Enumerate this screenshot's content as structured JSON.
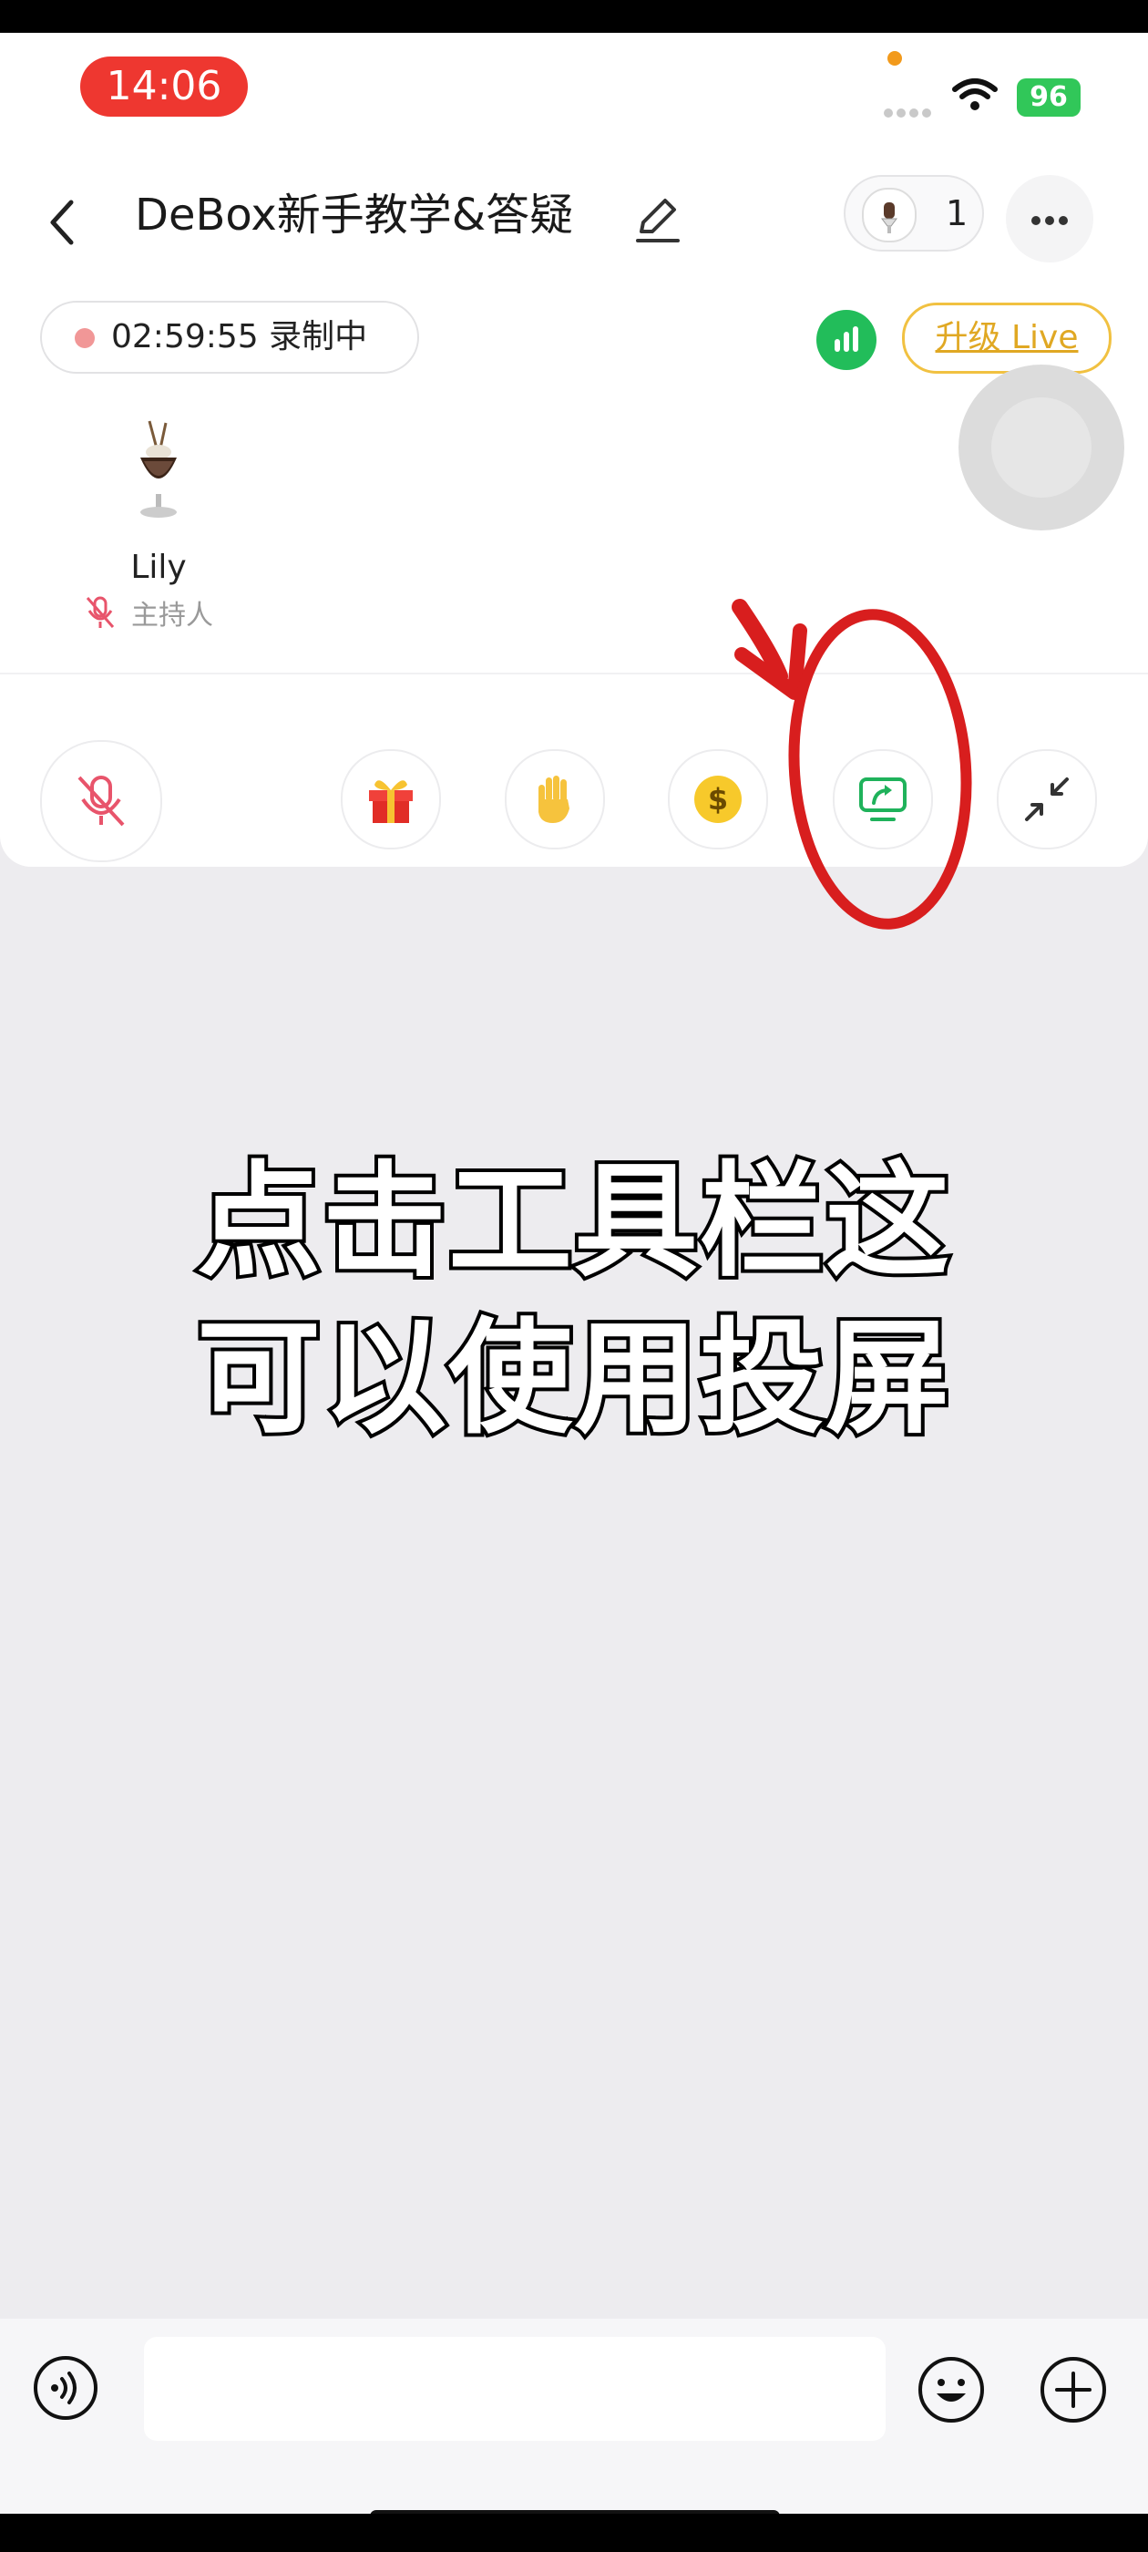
{
  "status_bar": {
    "time": "14:06",
    "battery": "96"
  },
  "header": {
    "title": "DeBox新手教学&答疑",
    "member_count": "1"
  },
  "recording": {
    "timer": "02:59:55",
    "status": "录制中"
  },
  "upgrade_label": "升级 Live",
  "host": {
    "name": "Lily",
    "role": "主持人"
  },
  "toolbar": {
    "items": [
      "mic-muted-icon",
      "gift-icon",
      "raise-hand-icon",
      "coin-icon",
      "screen-share-icon",
      "minimize-icon"
    ]
  },
  "caption": {
    "line1": "点击工具栏这",
    "line2": "可以使用投屏"
  },
  "input": {
    "value": "",
    "placeholder": ""
  },
  "colors": {
    "status_red": "#ee3730",
    "accent_green": "#22bd5a",
    "upgrade_gold": "#e0a823",
    "annotation_red": "#d81e1e"
  }
}
